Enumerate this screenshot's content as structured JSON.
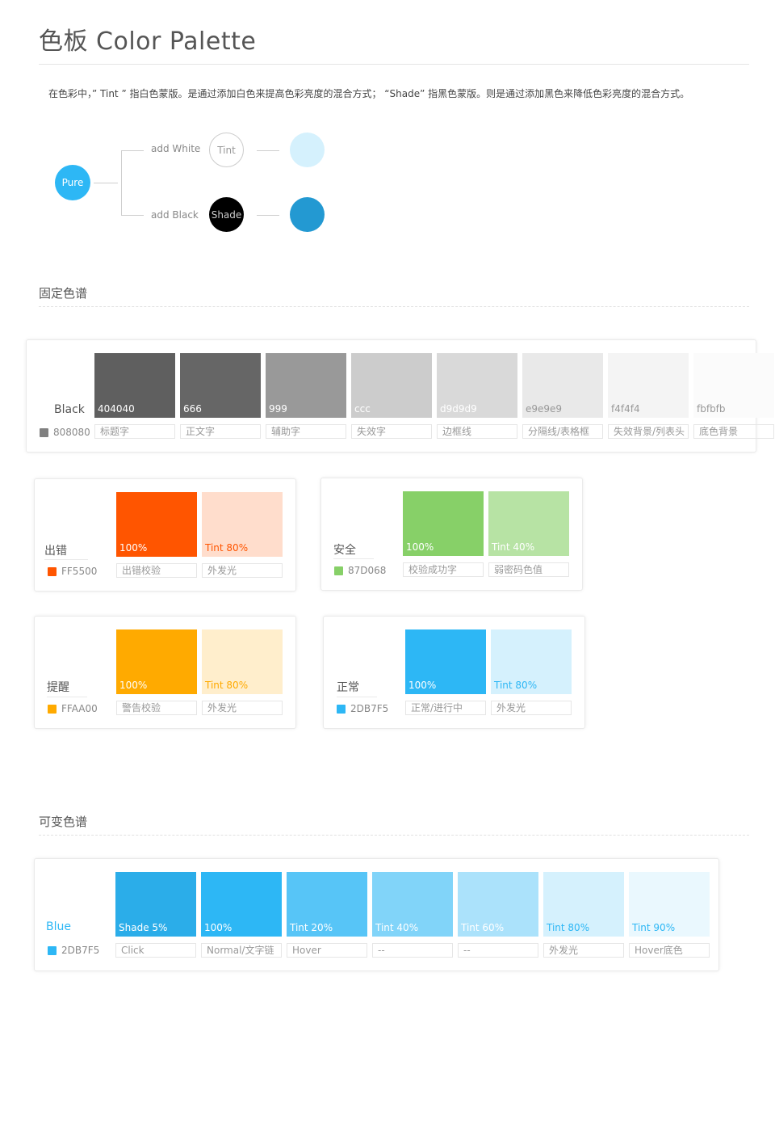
{
  "title": "色板 Color Palette",
  "intro": "在色彩中，” Tint ” 指白色蒙版。是通过添加白色来提高色彩亮度的混合方式；  “Shade” 指黑色蒙版。则是通过添加黑色来降低色彩亮度的混合方式。",
  "diagram": {
    "pure": "Pure",
    "add_white": "add White",
    "add_black": "add Black",
    "tint": "Tint",
    "shade": "Shade",
    "colors": {
      "pure": "#2DB7F5",
      "tint_result": "#D5F1FD",
      "shade": "#000000",
      "shade_result": "#2399D2"
    }
  },
  "fixed_section_title": "固定色谱",
  "variable_section_title": "可变色谱",
  "black_group": {
    "name": "Black",
    "hex": "808080",
    "hex_color": "#808080",
    "swatches": [
      {
        "label": "404040",
        "caption": "标题字",
        "color": "#5f5f5f",
        "text_color": "#ffffff"
      },
      {
        "label": "666",
        "caption": "正文字",
        "color": "#666666",
        "text_color": "#ffffff"
      },
      {
        "label": "999",
        "caption": "辅助字",
        "color": "#999999",
        "text_color": "#ffffff"
      },
      {
        "label": "ccc",
        "caption": "失效字",
        "color": "#cccccc",
        "text_color": "#ffffff"
      },
      {
        "label": "d9d9d9",
        "caption": "边框线",
        "color": "#d9d9d9",
        "text_color": "#ffffff"
      },
      {
        "label": "e9e9e9",
        "caption": "分隔线/表格框",
        "color": "#e9e9e9",
        "text_color": "#999999"
      },
      {
        "label": "f4f4f4",
        "caption": "失效背景/列表头",
        "color": "#f4f4f4",
        "text_color": "#999999"
      },
      {
        "label": "fbfbfb",
        "caption": "底色背景",
        "color": "#fbfbfb",
        "text_color": "#999999"
      }
    ]
  },
  "groups": [
    {
      "name": "出错",
      "hex": "FF5500",
      "hex_color": "#FF5500",
      "swatches": [
        {
          "label": "100%",
          "caption": "出错校验",
          "color": "#FF5500",
          "text_color": "#ffffff"
        },
        {
          "label": "Tint 80%",
          "caption": "外发光",
          "color": "#FFDDCC",
          "text_color": "#FF5500"
        }
      ]
    },
    {
      "name": "安全",
      "hex": "87D068",
      "hex_color": "#87D068",
      "swatches": [
        {
          "label": "100%",
          "caption": "校验成功字",
          "color": "#87D068",
          "text_color": "#ffffff"
        },
        {
          "label": "Tint 40%",
          "caption": "弱密码色值",
          "color": "#B7E3A4",
          "text_color": "#ffffff"
        }
      ]
    },
    {
      "name": "提醒",
      "hex": "FFAA00",
      "hex_color": "#FFAA00",
      "swatches": [
        {
          "label": "100%",
          "caption": "警告校验",
          "color": "#FFAA00",
          "text_color": "#ffffff"
        },
        {
          "label": "Tint 80%",
          "caption": "外发光",
          "color": "#FFEECC",
          "text_color": "#FFAA00"
        }
      ]
    },
    {
      "name": "正常",
      "hex": "2DB7F5",
      "hex_color": "#2DB7F5",
      "swatches": [
        {
          "label": "100%",
          "caption": "正常/进行中",
          "color": "#2DB7F5",
          "text_color": "#ffffff"
        },
        {
          "label": "Tint 80%",
          "caption": "外发光",
          "color": "#D5F1FD",
          "text_color": "#2DB7F5"
        }
      ]
    }
  ],
  "blue_group": {
    "name": "Blue",
    "hex": "2DB7F5",
    "hex_color": "#2DB7F5",
    "swatches": [
      {
        "label": "Shade  5%",
        "caption": "Click",
        "color": "#2BADE9",
        "text_color": "#ffffff"
      },
      {
        "label": "100%",
        "caption": "Normal/文字链",
        "color": "#2DB7F5",
        "text_color": "#ffffff"
      },
      {
        "label": "Tint 20%",
        "caption": "Hover",
        "color": "#57C5F7",
        "text_color": "#ffffff"
      },
      {
        "label": "Tint 40%",
        "caption": "--",
        "color": "#81D4F9",
        "text_color": "#ffffff"
      },
      {
        "label": "Tint  60%",
        "caption": "--",
        "color": "#ABE2FB",
        "text_color": "#ffffff"
      },
      {
        "label": "Tint 80%",
        "caption": "外发光",
        "color": "#D5F1FD",
        "text_color": "#2DB7F5"
      },
      {
        "label": "Tint 90%",
        "caption": "Hover底色",
        "color": "#EAF8FE",
        "text_color": "#2DB7F5"
      }
    ]
  }
}
